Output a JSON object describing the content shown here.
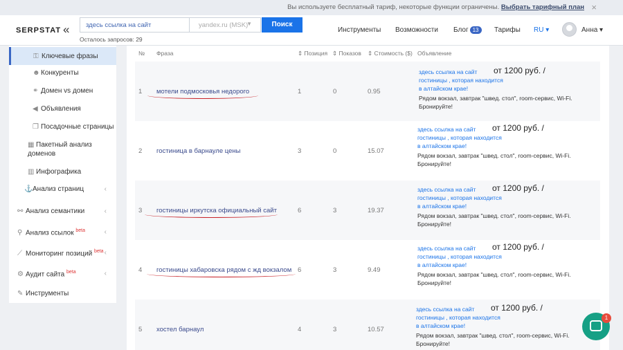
{
  "notice": {
    "text": "Вы используете бесплатный тариф, некоторые функции ограничены.",
    "link": "Выбрать тарифный план",
    "close": "×"
  },
  "header": {
    "logo": "SERPSTAT",
    "search_value": "здесь ссылка на сайт",
    "region": "yandex.ru (MSK)",
    "search_button": "Поиск",
    "remaining": "Осталось запросов: 29",
    "nav": [
      "Инструменты",
      "Возможности",
      "Блог",
      "Тарифы",
      "RU"
    ],
    "blog_count": "13",
    "user": "Анна"
  },
  "sidebar": {
    "items": [
      {
        "label": "Ключевые фразы",
        "icon": "key-icon",
        "active": true
      },
      {
        "label": "Конкуренты",
        "icon": "users-icon"
      },
      {
        "label": "Домен vs домен",
        "icon": "compare-icon"
      },
      {
        "label": "Объявления",
        "icon": "megaphone-icon"
      },
      {
        "label": "Посадочные страницы",
        "icon": "pages-icon"
      },
      {
        "label": "Пакетный анализ доменов",
        "icon": "grid-icon"
      },
      {
        "label": "Инфографика",
        "icon": "bar-chart-icon"
      },
      {
        "label": "Анализ страниц",
        "icon": "anchor-icon"
      },
      {
        "label": "Анализ семантики",
        "icon": "semantic-icon"
      },
      {
        "label": "Анализ ссылок",
        "icon": "search-icon",
        "beta": "beta"
      },
      {
        "label": "Мониторинг позиций",
        "icon": "line-chart-icon",
        "beta": "beta"
      },
      {
        "label": "Аудит сайта",
        "icon": "audit-icon",
        "beta": "beta"
      },
      {
        "label": "Инструменты",
        "icon": "wrench-icon"
      }
    ]
  },
  "table": {
    "headers": [
      "№",
      "Фраза",
      "Позиция",
      "Показов",
      "Стоимость ($)",
      "Объявление"
    ],
    "rows": [
      {
        "n": "1",
        "phrase": "мотели подмосковья недорого",
        "position": "1",
        "impressions": "0",
        "cost": "0.95"
      },
      {
        "n": "2",
        "phrase": "гостиница в барнауле цены",
        "position": "3",
        "impressions": "0",
        "cost": "15.07"
      },
      {
        "n": "3",
        "phrase": "гостиницы иркутска официальный сайт",
        "position": "6",
        "impressions": "3",
        "cost": "19.37"
      },
      {
        "n": "4",
        "phrase": "гостиницы хабаровска рядом с жд вокзалом",
        "position": "6",
        "impressions": "3",
        "cost": "9.49"
      },
      {
        "n": "5",
        "phrase": "хостел барнаул",
        "position": "4",
        "impressions": "3",
        "cost": "10.57"
      }
    ],
    "ad": {
      "title_line1": "здесь ссылка на сайт",
      "title_line2": "гостиницы , которая находится",
      "title_line3": "в алтайском крае!",
      "price": "от 1200 руб. /",
      "text": "Рядом вокзал, завтрак \"швед. стол\", room-сервис, Wi-Fi. Бронируйте!"
    }
  },
  "chat": {
    "badge": "1"
  },
  "colors": {
    "accent": "#1a73e8",
    "underline": "#c8242a",
    "chat": "#16a085"
  }
}
